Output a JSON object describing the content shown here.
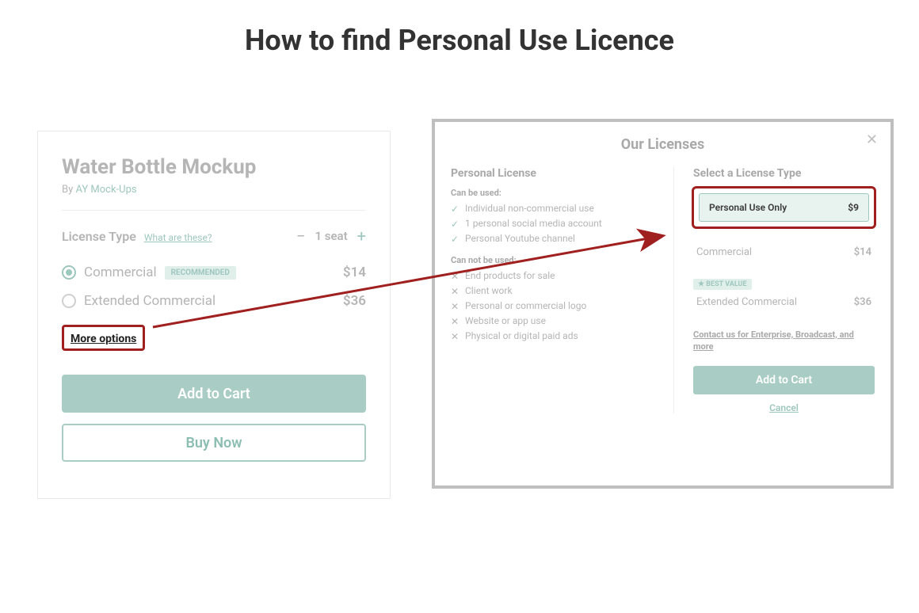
{
  "title": "How to find Personal Use Licence",
  "left": {
    "product_title": "Water Bottle Mockup",
    "by_prefix": "By ",
    "by_author": "AY Mock-Ups",
    "license_type_label": "License Type",
    "help_link": "What are these?",
    "seat_value": "1 seat",
    "opt_commercial_label": "Commercial",
    "recommended_badge": "RECOMMENDED",
    "opt_commercial_price": "$14",
    "opt_extended_label": "Extended Commercial",
    "opt_extended_price": "$36",
    "more_options": "More options",
    "add_to_cart": "Add to Cart",
    "buy_now": "Buy Now"
  },
  "right": {
    "modal_title": "Our Licenses",
    "personal_license_heading": "Personal License",
    "can_be_used": "Can be used:",
    "can_list": [
      "Individual non-commercial use",
      "1 personal social media account",
      "Personal Youtube channel"
    ],
    "cannot_be_used": "Can not be used:",
    "cannot_list": [
      "End products for sale",
      "Client work",
      "Personal or commercial logo",
      "Website or app use",
      "Physical or digital paid ads"
    ],
    "select_heading": "Select a License Type",
    "personal_only_label": "Personal Use Only",
    "personal_only_price": "$9",
    "commercial_label": "Commercial",
    "commercial_price": "$14",
    "best_value": "★ BEST VALUE",
    "extended_label": "Extended Commercial",
    "extended_price": "$36",
    "contact_text": "Contact us for Enterprise, Broadcast, and more",
    "add_to_cart": "Add to Cart",
    "cancel": "Cancel"
  }
}
